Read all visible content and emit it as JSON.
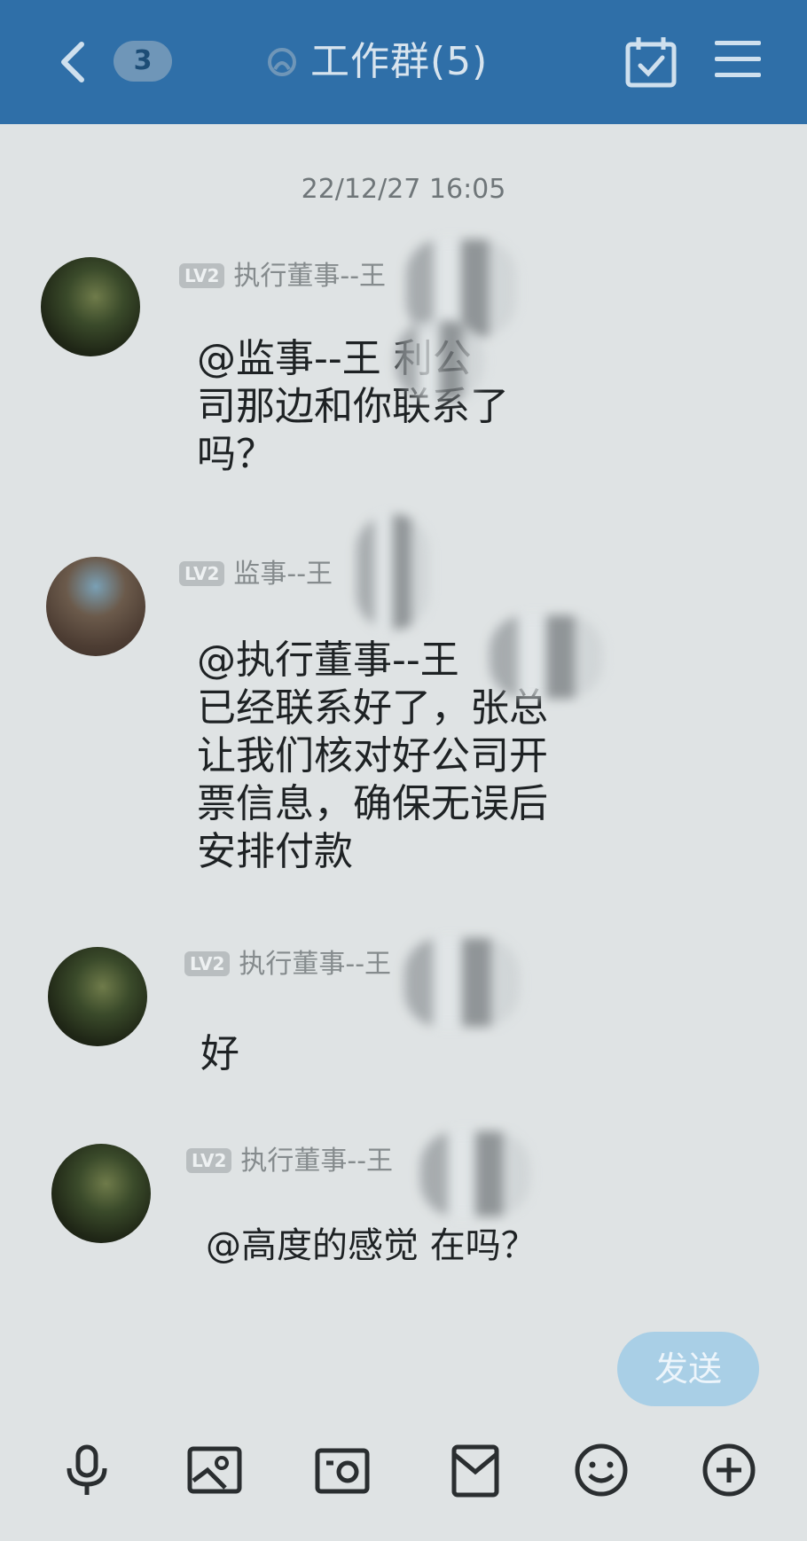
{
  "header": {
    "back_icon": "chevron-left-icon",
    "unread_count": "3",
    "title": "工作群(5)"
  },
  "timestamp": "22/12/27 16:05",
  "messages": [
    {
      "level": "LV2",
      "sender": "执行董事--王",
      "text": "@监事--王    利公\n司那边和你联系了\n吗？"
    },
    {
      "level": "LV2",
      "sender": "监事--王",
      "text": "@执行董事--王\n已经联系好了，张总\n让我们核对好公司开\n票信息，确保无误后\n安排付款"
    },
    {
      "level": "LV2",
      "sender": "执行董事--王",
      "text": "好"
    },
    {
      "level": "LV2",
      "sender": "执行董事--王",
      "text": "@高度的感觉 在吗？"
    }
  ],
  "input": {
    "send_label": "发送"
  },
  "toolbar": {
    "icons": [
      "microphone-icon",
      "image-icon",
      "camera-icon",
      "red-packet-icon",
      "emoji-icon",
      "plus-icon"
    ]
  },
  "colors": {
    "header_bg": "#2f6fa8",
    "send_button": "#a9cfe6",
    "background": "#dfe3e4"
  }
}
